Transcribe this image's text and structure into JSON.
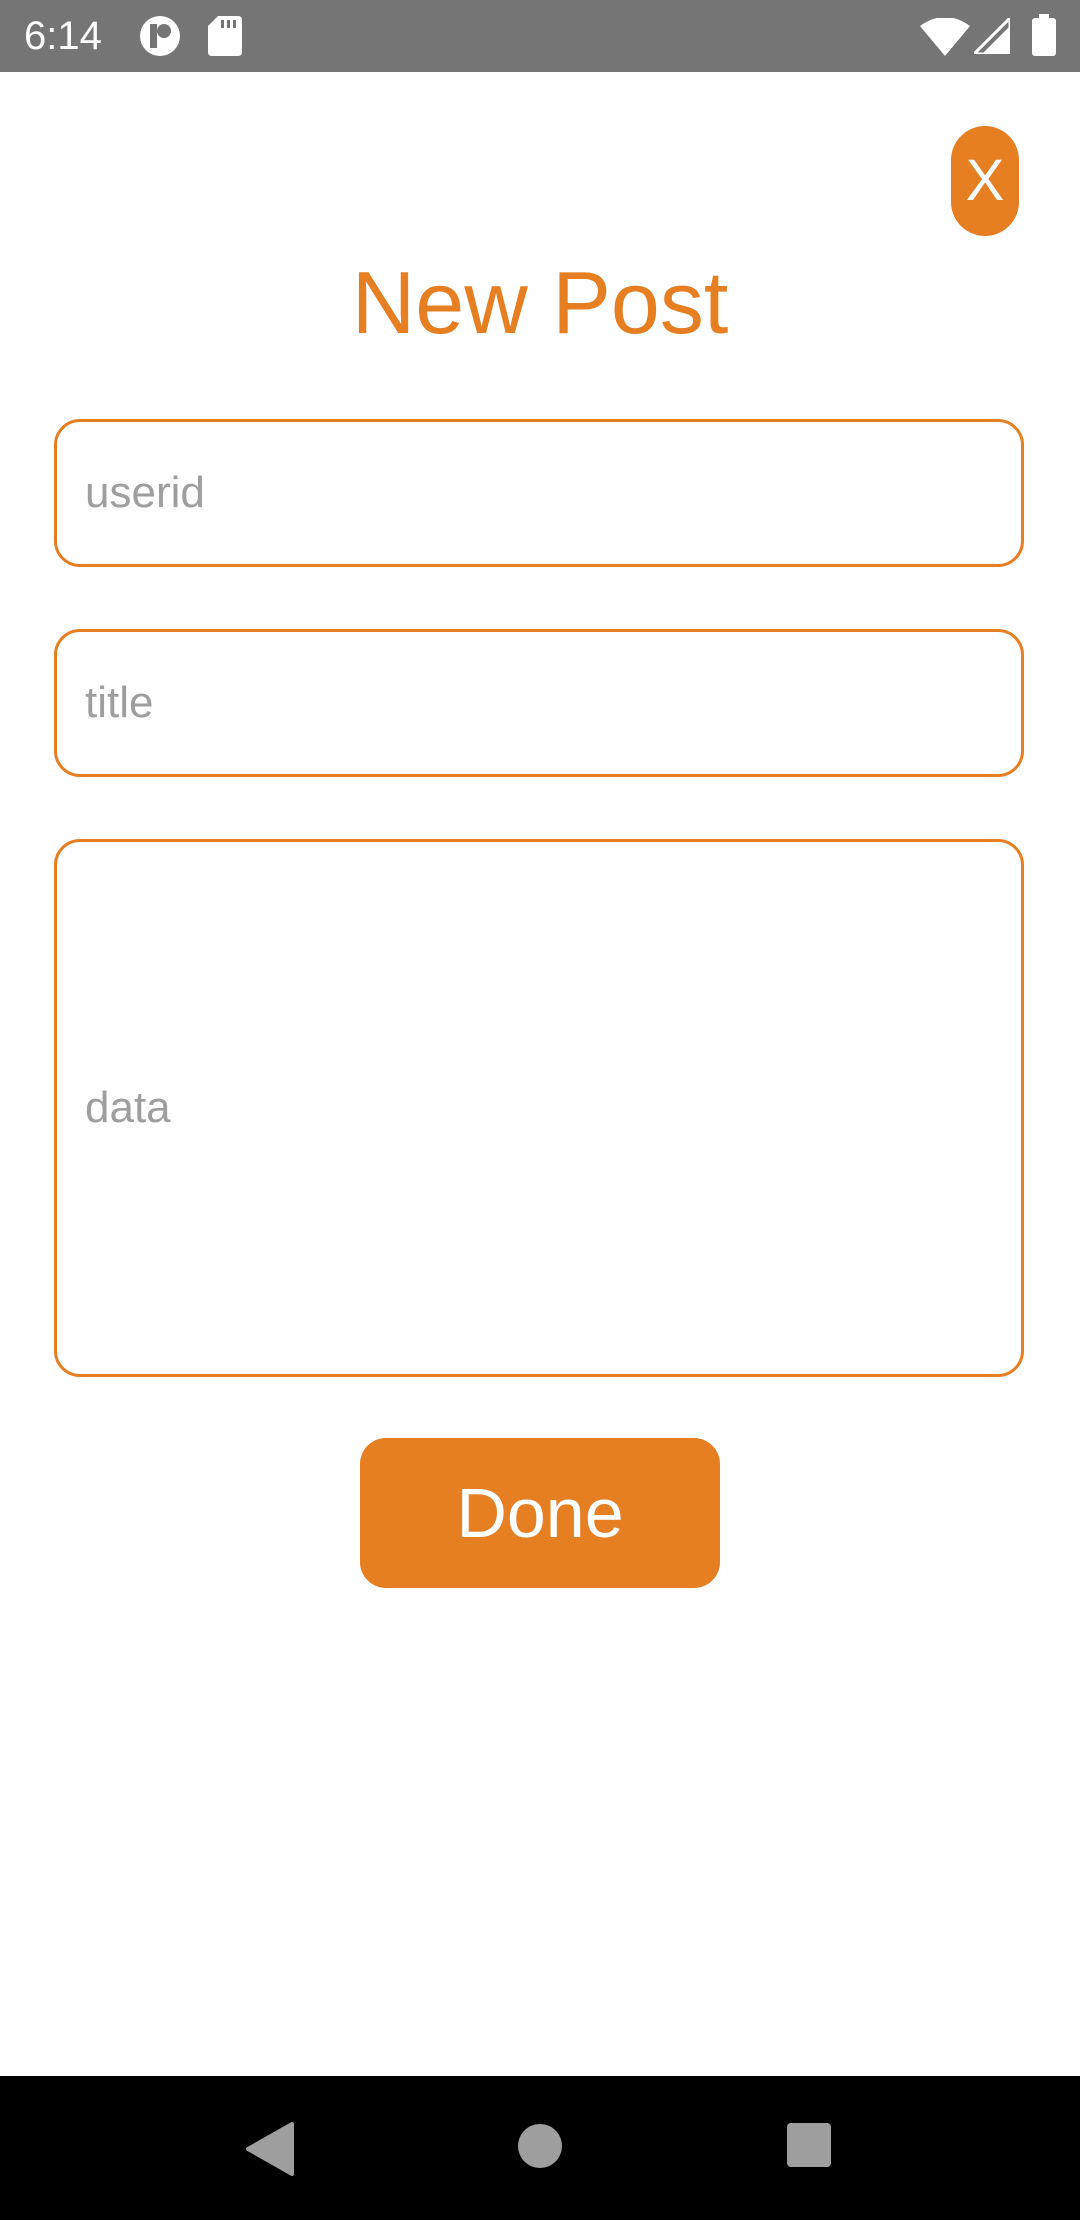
{
  "status_bar": {
    "time": "6:14",
    "icons": [
      "app-notification-icon",
      "sd-card-icon",
      "wifi-icon",
      "cell-signal-icon",
      "battery-icon"
    ]
  },
  "header": {
    "close_label": "X",
    "title": "New Post"
  },
  "form": {
    "userid_placeholder": "userid",
    "userid_value": "",
    "title_placeholder": "title",
    "title_value": "",
    "data_placeholder": "data",
    "data_value": "",
    "done_label": "Done"
  },
  "nav_bar": {
    "icons": [
      "back-icon",
      "home-icon",
      "recents-icon"
    ]
  },
  "colors": {
    "accent": "#e67e22",
    "status_bar": "#757575",
    "nav_bar": "#000000",
    "placeholder": "#9e9e9e"
  }
}
